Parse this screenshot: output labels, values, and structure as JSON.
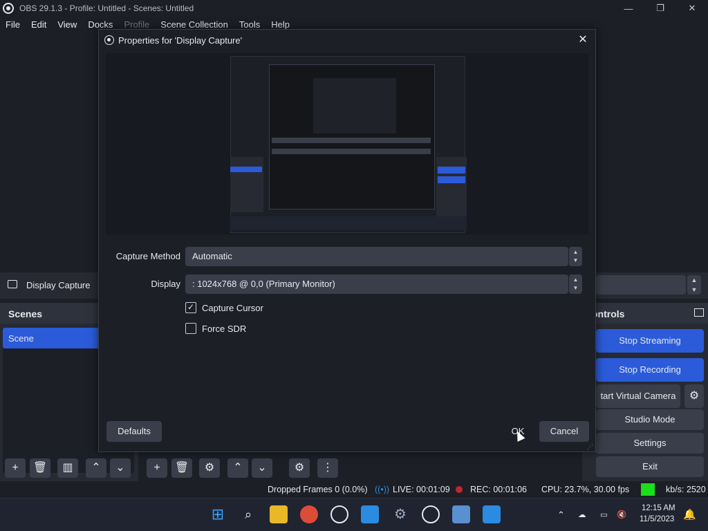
{
  "window": {
    "title": "OBS 29.1.3 - Profile: Untitled - Scenes: Untitled",
    "minimize": "—",
    "maximize": "❐",
    "close": "✕"
  },
  "menu": [
    "File",
    "Edit",
    "View",
    "Docks",
    "Profile",
    "Scene Collection",
    "Tools",
    "Help"
  ],
  "source": {
    "name": "Display Capture"
  },
  "scenes": {
    "title": "Scenes",
    "items": [
      "Scene"
    ]
  },
  "controls": {
    "title": "ontrols",
    "stop_streaming": "Stop Streaming",
    "stop_recording": "Stop Recording",
    "virtual_camera": "tart Virtual Camera",
    "studio_mode": "Studio Mode",
    "settings": "Settings",
    "exit": "Exit"
  },
  "dialog": {
    "title": "Properties for 'Display Capture'",
    "capture_method_label": "Capture Method",
    "capture_method_value": "Automatic",
    "display_label": "Display",
    "display_value": ": 1024x768 @ 0,0 (Primary Monitor)",
    "capture_cursor_label": "Capture Cursor",
    "capture_cursor_checked": true,
    "force_sdr_label": "Force SDR",
    "force_sdr_checked": false,
    "defaults_button": "Defaults",
    "ok_button": "OK",
    "cancel_button": "Cancel"
  },
  "status": {
    "dropped_frames": "Dropped Frames 0 (0.0%)",
    "live": "LIVE: 00:01:09",
    "rec": "REC: 00:01:06",
    "cpu": "CPU: 23.7%, 30.00 fps",
    "kbs": "kb/s: 2520"
  },
  "taskbar": {
    "time": "12:15 AM",
    "date": "11/5/2023"
  },
  "colors": {
    "accent_blue": "#2b5bd9",
    "rec_red": "#c0282d",
    "status_green": "#1adf1a"
  }
}
